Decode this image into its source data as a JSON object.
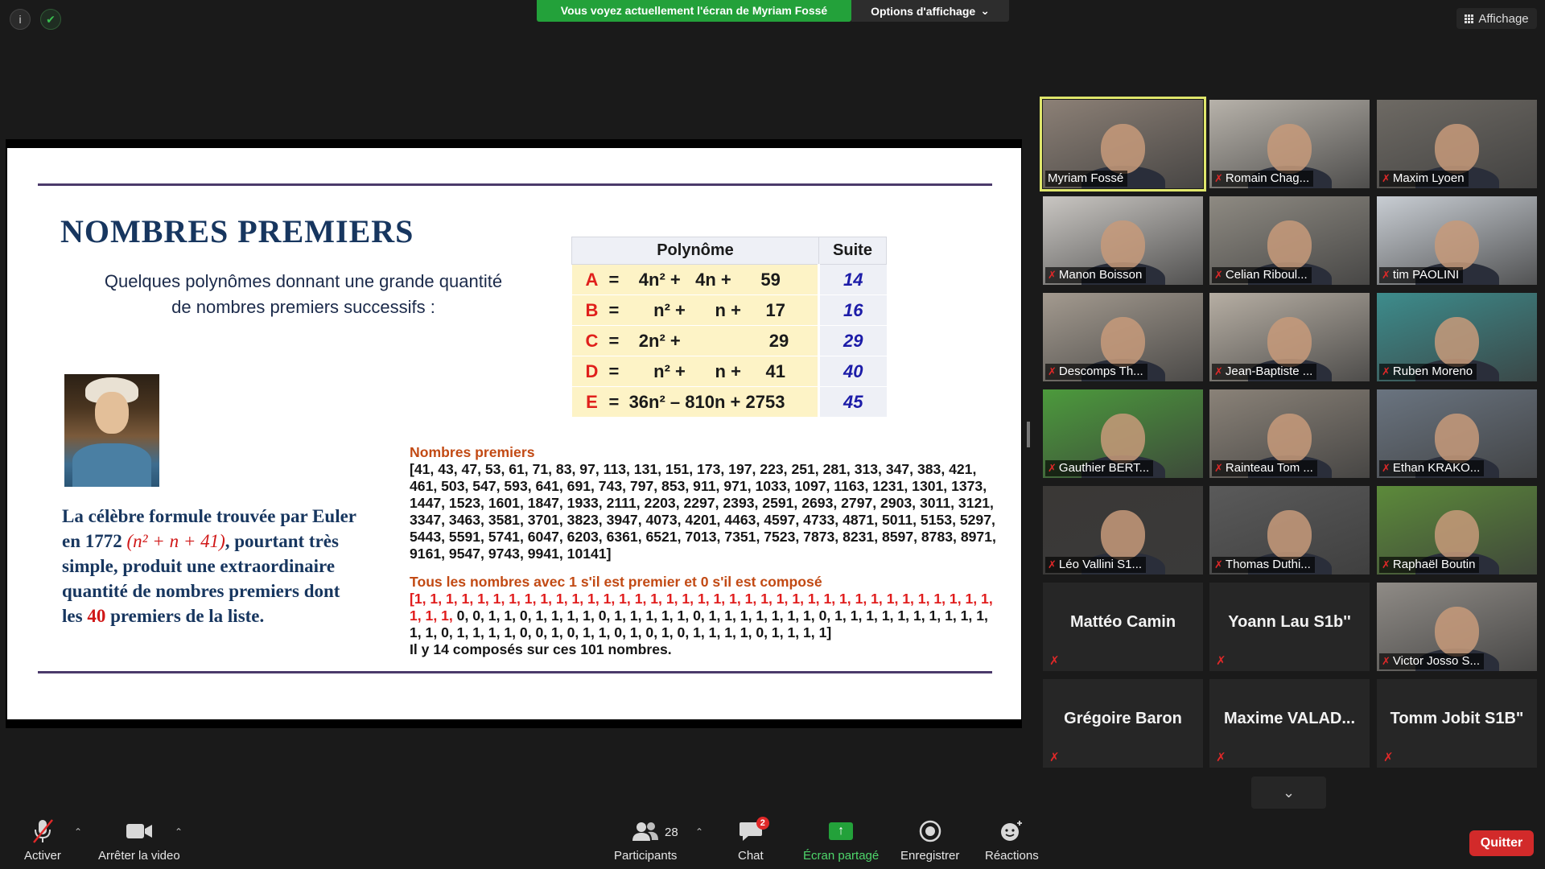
{
  "top": {
    "info_icon": "info-icon",
    "security_icon": "shield-check-icon",
    "banner": "Vous voyez actuellement l'écran de Myriam Fossé",
    "view_options": "Options d'affichage",
    "view_options_caret": "⌄",
    "layout_button": "Affichage"
  },
  "slide": {
    "title": "NOMBRES PREMIERS",
    "subtitle": "Quelques polynômes donnant une grande quantité de nombres premiers successifs :",
    "table": {
      "header_poly": "Polynôme",
      "header_suite": "Suite",
      "rows": [
        {
          "letter": "A",
          "expr": "=    4n² +   4n +      59",
          "suite": "14"
        },
        {
          "letter": "B",
          "expr": "=       n² +      n +     17",
          "suite": "16"
        },
        {
          "letter": "C",
          "expr": "=    2n² +                  29",
          "suite": "29"
        },
        {
          "letter": "D",
          "expr": "=       n² +      n +     41",
          "suite": "40"
        },
        {
          "letter": "E",
          "expr": "=  36n² – 810n + 2753",
          "suite": "45"
        }
      ]
    },
    "euler": {
      "line_a": "La célèbre formule trouvée par Euler en 1772 ",
      "formula": "(n² + n + 41)",
      "line_b": ", pourtant très simple, produit une extraordinaire quantité de nombres premiers dont les ",
      "forty": "40",
      "line_c": " premiers de la liste."
    },
    "primes_heading": "Nombres premiers",
    "primes_list": "[41, 43, 47, 53, 61, 71, 83, 97, 113, 131, 151, 173, 197, 223, 251, 281, 313, 347, 383, 421, 461, 503, 547, 593, 641, 691, 743, 797, 853, 911, 971, 1033, 1097, 1163, 1231, 1301, 1373, 1447, 1523, 1601, 1847, 1933, 2111, 2203, 2297, 2393, 2591, 2693, 2797, 2903, 3011, 3121, 3347, 3463, 3581, 3701, 3823, 3947, 4073, 4201, 4463, 4597, 4733, 4871, 5011, 5153, 5297, 5443, 5591, 5741, 6047, 6203, 6361, 6521, 7013, 7351, 7523, 7873, 8231, 8597, 8783, 8971, 9161, 9547, 9743, 9941, 10141]",
    "binary_heading": "Tous les nombres avec 1 s'il est premier et 0 s'il est composé",
    "binary_red": "[1, 1, 1, 1, 1, 1, 1, 1, 1, 1, 1, 1, 1, 1, 1, 1, 1, 1, 1, 1, 1, 1, 1, 1, 1, 1, 1, 1, 1, 1, 1, 1, 1, 1, 1, 1, 1, 1, 1, 1,",
    "binary_rest": " 0, 0, 1, 1, 0, 1, 1, 1, 1, 0, 1, 1, 1, 1, 1, 0, 1, 1, 1, 1, 1, 1, 1, 0, 1, 1, 1, 1, 1, 1, 1, 1, 1, 1, 1, 1, 0, 1, 1, 1, 1, 0, 0, 1, 0, 1, 1, 0, 1, 0, 1, 0, 1, 1, 1, 1, 0, 1, 1, 1, 1]",
    "composites": "Il y 14 composés sur ces 101 nombres."
  },
  "participants": [
    {
      "name": "Myriam Fossé",
      "muted": "",
      "active": true,
      "bg": "#8c8076"
    },
    {
      "name": "Romain Chag...",
      "muted": "✗",
      "bg": "#b7b2aa"
    },
    {
      "name": "Maxim Lyoen",
      "muted": "✗",
      "bg": "#6e6a64"
    },
    {
      "name": "Manon Boisson",
      "muted": "✗",
      "bg": "#c9c6c2"
    },
    {
      "name": "Celian Riboul...",
      "muted": "✗",
      "bg": "#8e8a82"
    },
    {
      "name": "tim PAOLINI",
      "muted": "✗",
      "bg": "#c8cdd3"
    },
    {
      "name": "Descomps Th...",
      "muted": "✗",
      "bg": "#a39a8f"
    },
    {
      "name": "Jean-Baptiste ...",
      "muted": "✗",
      "bg": "#b6aea3"
    },
    {
      "name": "Ruben Moreno",
      "muted": "✗",
      "bg": "#3d8c8c"
    },
    {
      "name": "Gauthier BERT...",
      "muted": "✗",
      "bg": "#4c9a3c"
    },
    {
      "name": "Rainteau Tom ...",
      "muted": "✗",
      "bg": "#8a8278"
    },
    {
      "name": "Ethan KRAKO...",
      "muted": "✗",
      "bg": "#6a7480"
    },
    {
      "name": "Léo Vallini S1...",
      "muted": "✗",
      "bg": "#3a3836"
    },
    {
      "name": "Thomas Duthi...",
      "muted": "✗",
      "bg": "#5a5a5a"
    },
    {
      "name": "Raphaël Boutin",
      "muted": "✗",
      "bg": "#5c8a3a"
    },
    {
      "name": "Mattéo Camin",
      "muted": "✗",
      "video": false
    },
    {
      "name": "Yoann Lau S1b''",
      "muted": "✗",
      "video": false
    },
    {
      "name": "Victor Josso S...",
      "muted": "✗",
      "bg": "#8f8b86"
    },
    {
      "name": "Grégoire Baron",
      "muted": "✗",
      "video": false
    },
    {
      "name": "Maxime  VALAD...",
      "muted": "✗",
      "video": false
    },
    {
      "name": "Tomm Jobit S1B\"",
      "muted": "✗",
      "video": false
    }
  ],
  "gallery_more": "⌄",
  "toolbar": {
    "mute_label": "Activer",
    "video_label": "Arrêter la video",
    "participants_label": "Participants",
    "participants_count": "28",
    "chat_label": "Chat",
    "chat_badge": "2",
    "share_label": "Écran partagé",
    "record_label": "Enregistrer",
    "reactions_label": "Réactions",
    "quit_label": "Quitter"
  },
  "colors": {
    "banner": "#23a13a",
    "active_speaker": "#dfe66b",
    "quit": "#d22a2a",
    "slide_title": "#17365f"
  }
}
